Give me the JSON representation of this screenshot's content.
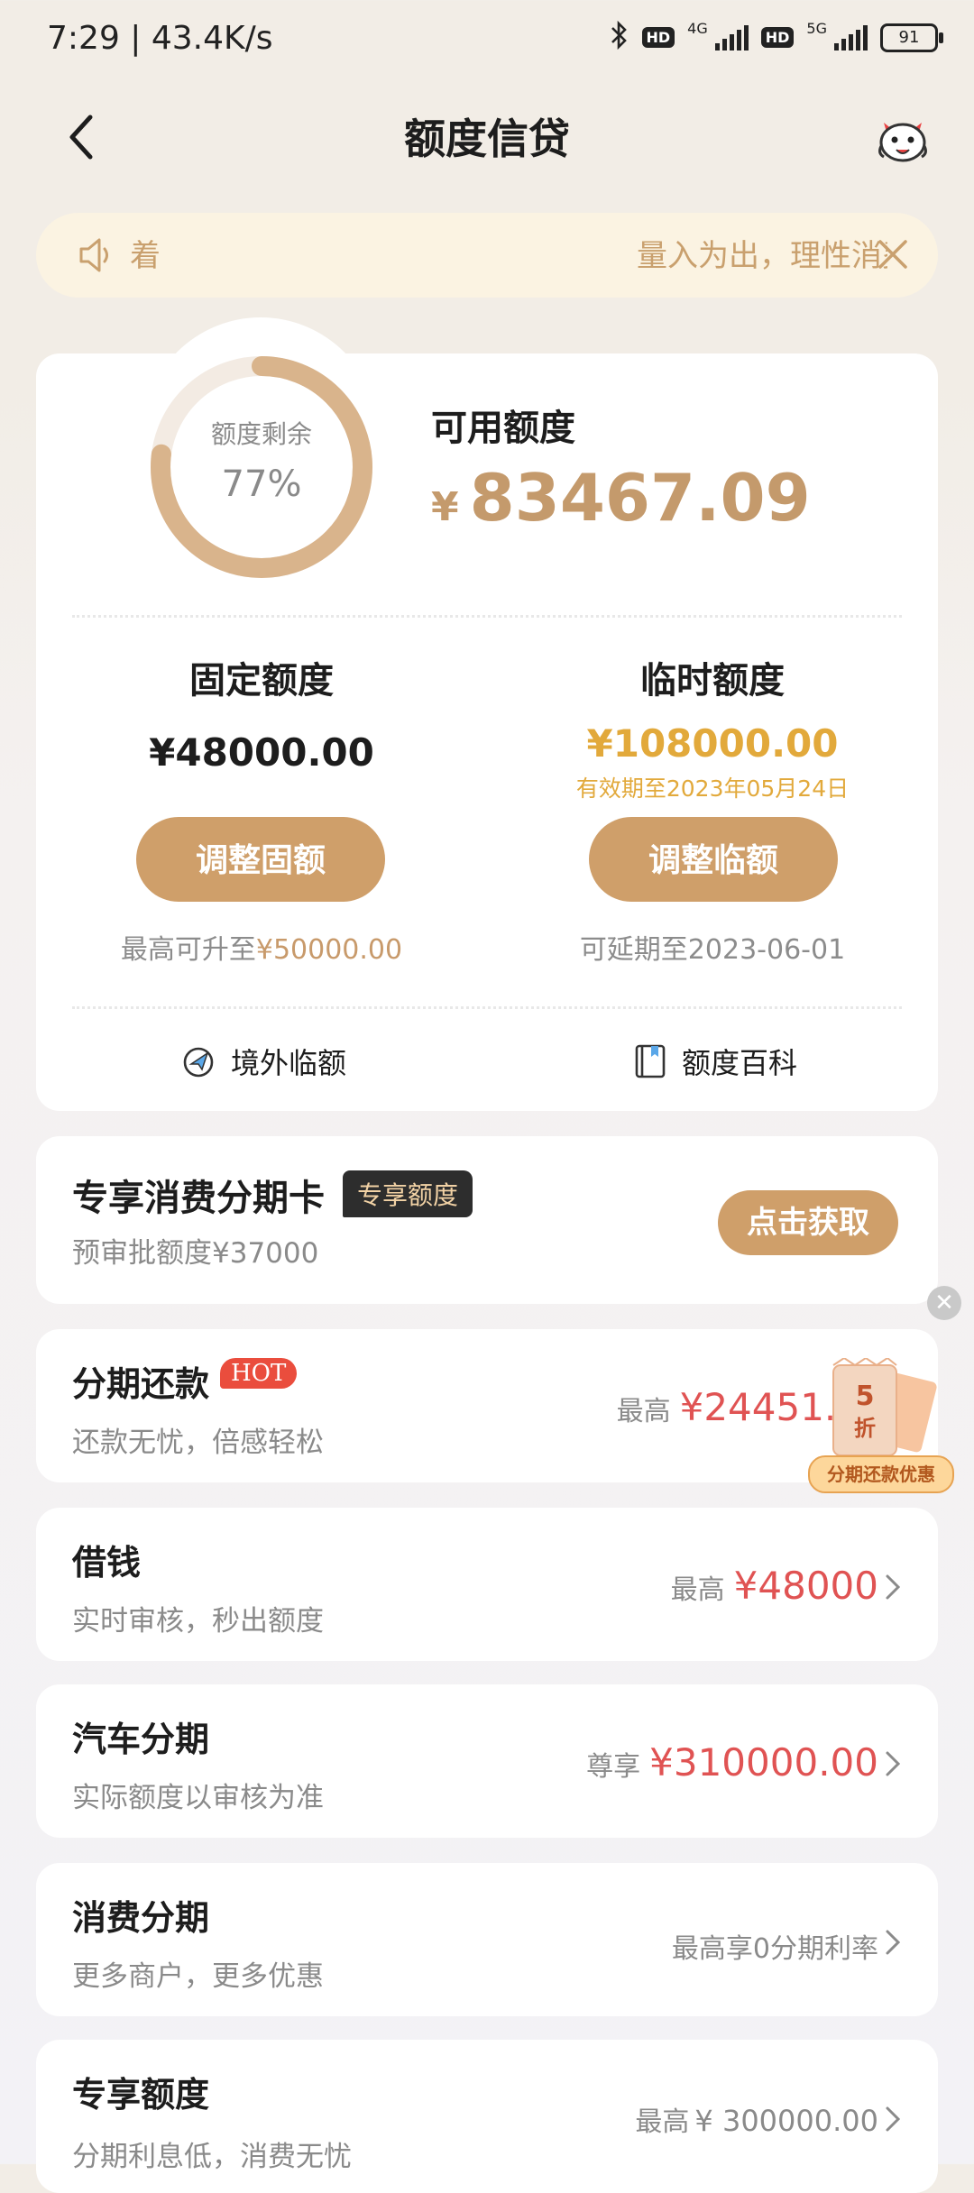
{
  "status_bar": {
    "time": "7:29 | 43.4K/s",
    "net1": "4G",
    "net2": "5G",
    "hd": "HD",
    "battery": "91"
  },
  "header": {
    "title": "额度信贷"
  },
  "notice": {
    "ticker_start": "着",
    "text": "量入为出，理性消费"
  },
  "credit": {
    "ring_label": "额度剩余",
    "remaining_percent_text": "77%",
    "remaining_fraction": 0.77,
    "available_label": "可用额度",
    "currency": "¥",
    "available_amount": "83467.09",
    "fixed": {
      "title": "固定额度",
      "amount": "¥48000.00",
      "button": "调整固额",
      "hint_prefix": "最高可升至",
      "hint_amount": "¥50000.00"
    },
    "temporary": {
      "title": "临时额度",
      "amount": "¥108000.00",
      "validity": "有效期至2023年05月24日",
      "button": "调整临额",
      "hint": "可延期至2023-06-01"
    },
    "links": {
      "overseas": "境外临额",
      "wiki": "额度百科"
    }
  },
  "special_card": {
    "title": "专享消费分期卡",
    "tag": "专享额度",
    "subtitle": "预审批额度¥37000",
    "button": "点击获取"
  },
  "list": [
    {
      "title": "分期还款",
      "badge": "HOT",
      "subtitle": "还款无忧，倍感轻松",
      "prefix": "最高",
      "amount": "¥24451.0"
    },
    {
      "title": "借钱",
      "subtitle": "实时审核，秒出额度",
      "prefix": "最高",
      "amount": "¥48000"
    },
    {
      "title": "汽车分期",
      "subtitle": "实际额度以审核为准",
      "prefix": "尊享",
      "amount": "¥310000.00"
    },
    {
      "title": "消费分期",
      "subtitle": "更多商户，更多优惠",
      "prefix": "最高享0分期利率",
      "amount": ""
    },
    {
      "title": "专享额度",
      "subtitle": "分期利息低，消费无忧",
      "prefix": "最高",
      "amount": "¥ 300000.00"
    }
  ],
  "promo": {
    "number": "5",
    "unit": "折",
    "label": "分期还款优惠"
  },
  "colors": {
    "gold": "#cf9f6a",
    "amount_red": "#e05353",
    "temp_yellow": "#e2a93b"
  }
}
